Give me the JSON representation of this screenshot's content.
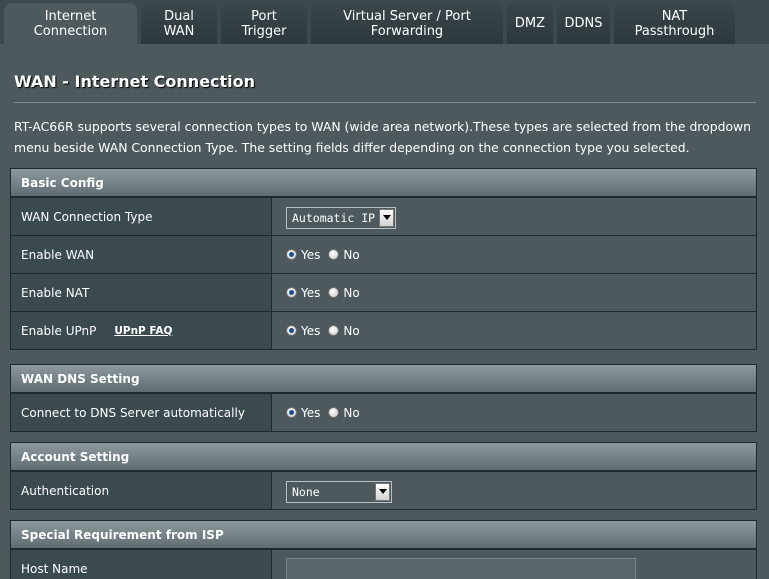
{
  "tabs": [
    {
      "label": "Internet\nConnection",
      "active": true
    },
    {
      "label": "Dual\nWAN",
      "active": false
    },
    {
      "label": "Port\nTrigger",
      "active": false
    },
    {
      "label": "Virtual Server / Port\nForwarding",
      "active": false
    },
    {
      "label": "DMZ",
      "active": false
    },
    {
      "label": "DDNS",
      "active": false
    },
    {
      "label": "NAT\nPassthrough",
      "active": false
    }
  ],
  "page": {
    "title": "WAN - Internet Connection",
    "description": "RT-AC66R supports several connection types to WAN (wide area network).These types are selected from the dropdown menu beside WAN Connection Type. The setting fields differ depending on the connection type you selected."
  },
  "radio": {
    "yes": "Yes",
    "no": "No"
  },
  "basic": {
    "header": "Basic Config",
    "wan_type_label": "WAN Connection Type",
    "wan_type_value": "Automatic IP",
    "enable_wan_label": "Enable WAN",
    "enable_nat_label": "Enable NAT",
    "enable_upnp_label": "Enable UPnP",
    "upnp_faq": "UPnP FAQ"
  },
  "dns": {
    "header": "WAN DNS Setting",
    "auto_label": "Connect to DNS Server automatically"
  },
  "account": {
    "header": "Account Setting",
    "auth_label": "Authentication",
    "auth_value": "None"
  },
  "isp": {
    "header": "Special Requirement from ISP",
    "host_label": "Host Name",
    "host_value": ""
  },
  "colors": {
    "background": "#4d595d",
    "label_cell": "#3b4a4f",
    "header_bar": "#8d999d"
  }
}
